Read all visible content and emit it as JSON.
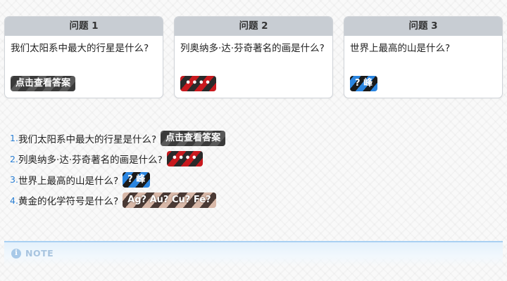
{
  "cards": [
    {
      "header": "问题 1",
      "question": "我们太阳系中最大的行星是什么?",
      "spoiler": "点击查看答案"
    },
    {
      "header": "问题 2",
      "question": "列奥纳多·达·芬奇著名的画是什么?",
      "spoiler": "••••"
    },
    {
      "header": "问题 3",
      "question": "世界上最高的山是什么?",
      "spoiler": "? 峰"
    }
  ],
  "list": [
    {
      "number": "1.",
      "question": "我们太阳系中最大的行星是什么?",
      "spoiler": "点击查看答案"
    },
    {
      "number": "2.",
      "question": "列奥纳多·达·芬奇著名的画是什么?",
      "spoiler": "••••"
    },
    {
      "number": "3.",
      "question": "世界上最高的山是什么?",
      "spoiler": "? 峰"
    },
    {
      "number": "4.",
      "question": "黄金的化学符号是什么?",
      "spoiler": "Ag? Au? Cu? Fe?"
    }
  ],
  "note": {
    "icon": "info-icon",
    "label": "NOTE"
  },
  "colors": {
    "card_header_bg": "#c8cdd3",
    "list_number": "#2a7fd4",
    "spoiler_dark": "#3a3a3a",
    "spoiler_red": "#c9191e",
    "spoiler_blue": "#2a85e0",
    "spoiler_tan": "#d8b8a8",
    "note_border": "#a9d0f2"
  }
}
